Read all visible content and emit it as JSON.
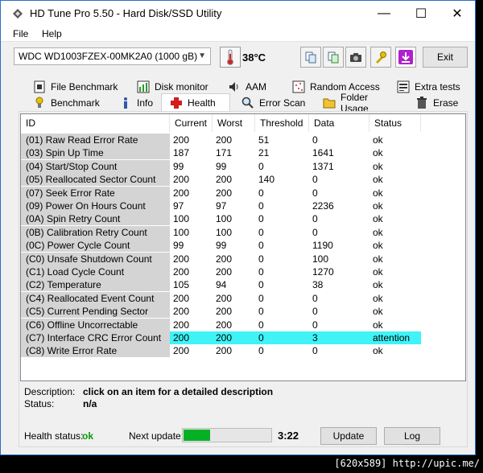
{
  "window": {
    "title": "HD Tune Pro 5.50 - Hard Disk/SSD Utility",
    "controls": {
      "minimize": "—",
      "maximize": "☐",
      "close": "✕"
    }
  },
  "menu": {
    "file": "File",
    "help": "Help"
  },
  "toolbar": {
    "drive": "WDC WD1003FZEX-00MK2A0 (1000 gB)",
    "temperature": "38°C",
    "exit_label": "Exit",
    "icons": [
      "copy-icon",
      "copy-info-icon",
      "screenshot-icon",
      "options-icon",
      "save-icon"
    ]
  },
  "tabs_row1": [
    {
      "label": "File Benchmark",
      "icon": "file-benchmark-icon"
    },
    {
      "label": "Disk monitor",
      "icon": "disk-monitor-icon"
    },
    {
      "label": "AAM",
      "icon": "aam-icon"
    },
    {
      "label": "Random Access",
      "icon": "random-access-icon"
    },
    {
      "label": "Extra tests",
      "icon": "extra-tests-icon"
    }
  ],
  "tabs_row2": [
    {
      "label": "Benchmark",
      "icon": "benchmark-icon"
    },
    {
      "label": "Info",
      "icon": "info-icon"
    },
    {
      "label": "Health",
      "icon": "health-icon",
      "active": true
    },
    {
      "label": "Error Scan",
      "icon": "error-scan-icon"
    },
    {
      "label": "Folder Usage",
      "icon": "folder-usage-icon"
    },
    {
      "label": "Erase",
      "icon": "erase-icon"
    }
  ],
  "table": {
    "columns": [
      "ID",
      "Current",
      "Worst",
      "Threshold",
      "Data",
      "Status"
    ],
    "rows": [
      [
        "(01) Raw Read Error Rate",
        "200",
        "200",
        "51",
        "0",
        "ok"
      ],
      [
        "(03) Spin Up Time",
        "187",
        "171",
        "21",
        "1641",
        "ok"
      ],
      [
        "(04) Start/Stop Count",
        "99",
        "99",
        "0",
        "1371",
        "ok"
      ],
      [
        "(05) Reallocated Sector Count",
        "200",
        "200",
        "140",
        "0",
        "ok"
      ],
      [
        "(07) Seek Error Rate",
        "200",
        "200",
        "0",
        "0",
        "ok"
      ],
      [
        "(09) Power On Hours Count",
        "97",
        "97",
        "0",
        "2236",
        "ok"
      ],
      [
        "(0A) Spin Retry Count",
        "100",
        "100",
        "0",
        "0",
        "ok"
      ],
      [
        "(0B) Calibration Retry Count",
        "100",
        "100",
        "0",
        "0",
        "ok"
      ],
      [
        "(0C) Power Cycle Count",
        "99",
        "99",
        "0",
        "1190",
        "ok"
      ],
      [
        "(C0) Unsafe Shutdown Count",
        "200",
        "200",
        "0",
        "100",
        "ok"
      ],
      [
        "(C1) Load Cycle Count",
        "200",
        "200",
        "0",
        "1270",
        "ok"
      ],
      [
        "(C2) Temperature",
        "105",
        "94",
        "0",
        "38",
        "ok"
      ],
      [
        "(C4) Reallocated Event Count",
        "200",
        "200",
        "0",
        "0",
        "ok"
      ],
      [
        "(C5) Current Pending Sector",
        "200",
        "200",
        "0",
        "0",
        "ok"
      ],
      [
        "(C6) Offline Uncorrectable",
        "200",
        "200",
        "0",
        "0",
        "ok"
      ],
      [
        "(C7) Interface CRC Error Count",
        "200",
        "200",
        "0",
        "3",
        "attention"
      ],
      [
        "(C8) Write Error Rate",
        "200",
        "200",
        "0",
        "0",
        "ok"
      ]
    ],
    "selected_row": 15
  },
  "details": {
    "description_label": "Description:",
    "description_value": "click on an item for a detailed description",
    "status_label": "Status:",
    "status_value": "n/a"
  },
  "footer": {
    "health_label": "Health status:",
    "health_value": "ok",
    "next_update_label": "Next update:",
    "progress_fraction": 0.3,
    "next_update_time": "3:22",
    "update_label": "Update",
    "log_label": "Log"
  },
  "watermark": "[620x589] http://upic.me/",
  "colors": {
    "selected_row": "#3ff3f6",
    "health_ok": "#0a9a0a",
    "progress": "#06b025"
  }
}
